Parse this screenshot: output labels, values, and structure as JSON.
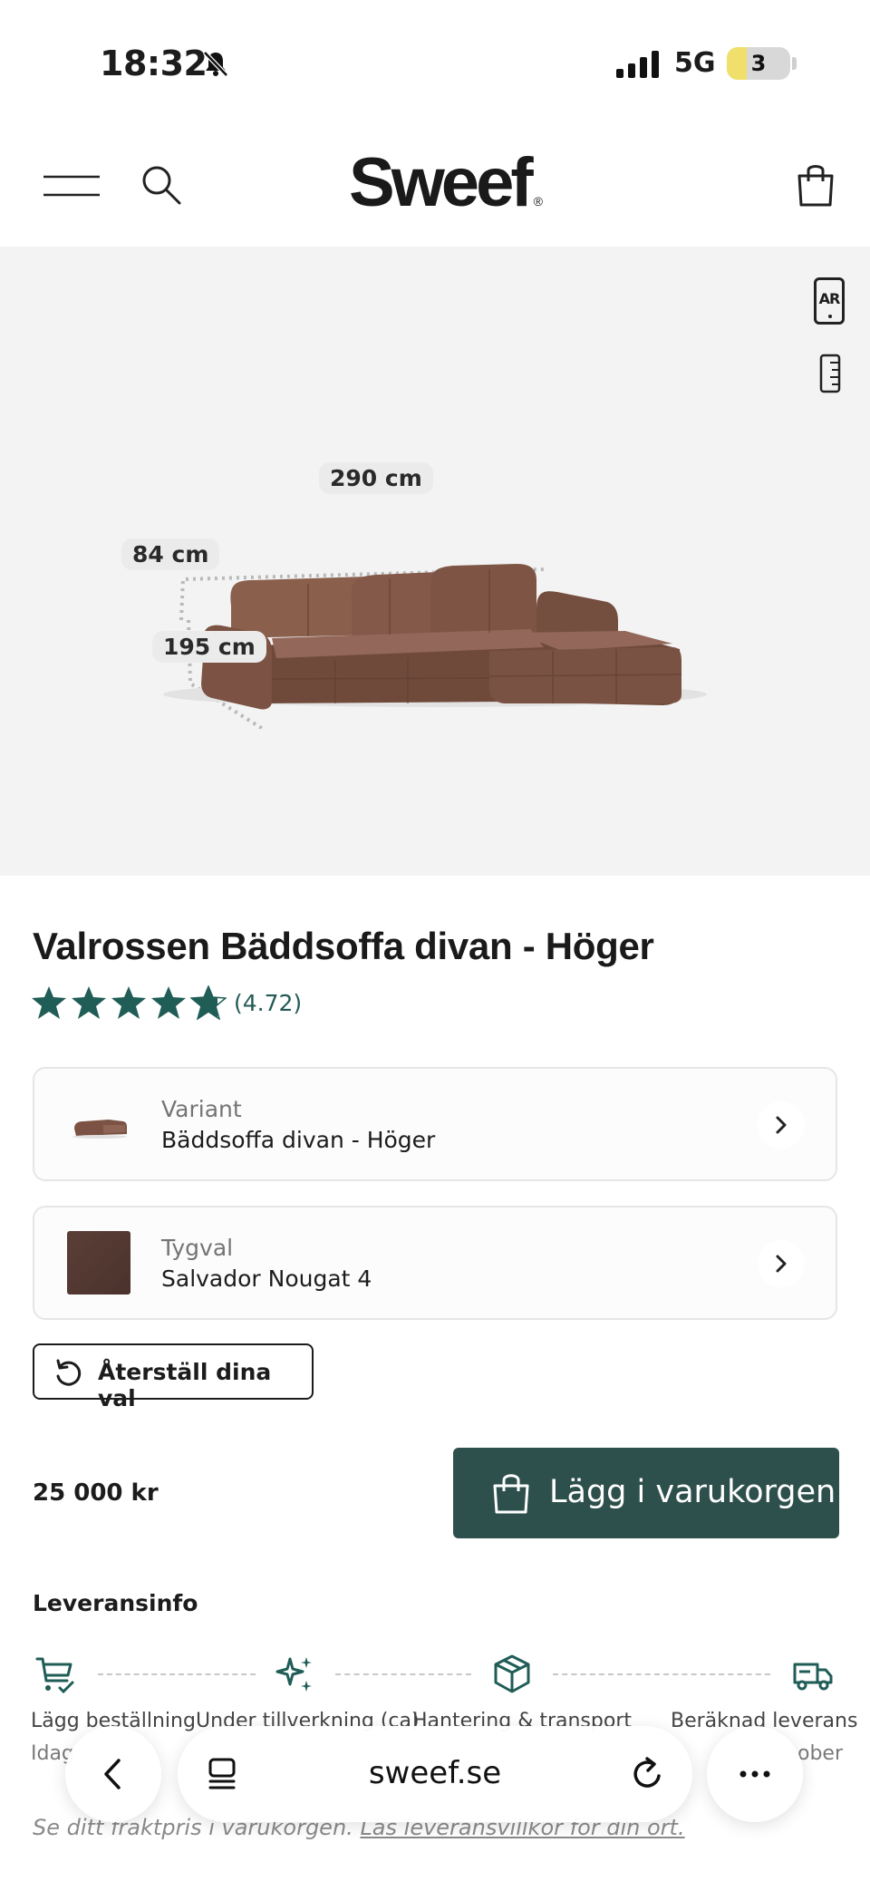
{
  "status_bar": {
    "time": "18:32",
    "network": "5G",
    "battery": "3"
  },
  "header": {
    "logo": "Sweef",
    "logo_mark": "®"
  },
  "hero": {
    "ar_label": "AR",
    "dimensions": {
      "width": "290 cm",
      "height": "84 cm",
      "depth": "195 cm"
    }
  },
  "product": {
    "title": "Valrossen Bäddsoffa divan - Höger",
    "rating_stars": 4.72,
    "rating_value": "(4.72)",
    "variant_label": "Variant",
    "variant_value": "Bäddsoffa divan - Höger",
    "fabric_label": "Tygval",
    "fabric_value": "Salvador Nougat 4",
    "reset_label": "Återställ dina val",
    "price": "25 000 kr",
    "cart_label": "Lägg i varukorgen"
  },
  "delivery": {
    "title": "Leveransinfo",
    "steps": [
      {
        "label": "Lägg beställning",
        "sub": "Idag"
      },
      {
        "label": "Under tillverkning (ca)",
        "sub": ""
      },
      {
        "label": "Hantering & transport",
        "sub": ""
      },
      {
        "label": "Beräknad leverans",
        "sub": "ober"
      }
    ],
    "freight_text": "Se ditt fraktpris i varukorgen.",
    "freight_link": "Läs leveransvillkor för din ort."
  },
  "browser": {
    "url": "sweef.se"
  },
  "colors": {
    "accent": "#2e504c",
    "star": "#1f5d56",
    "hero_bg": "#f3f3f3",
    "sofa": "#7d5543"
  }
}
